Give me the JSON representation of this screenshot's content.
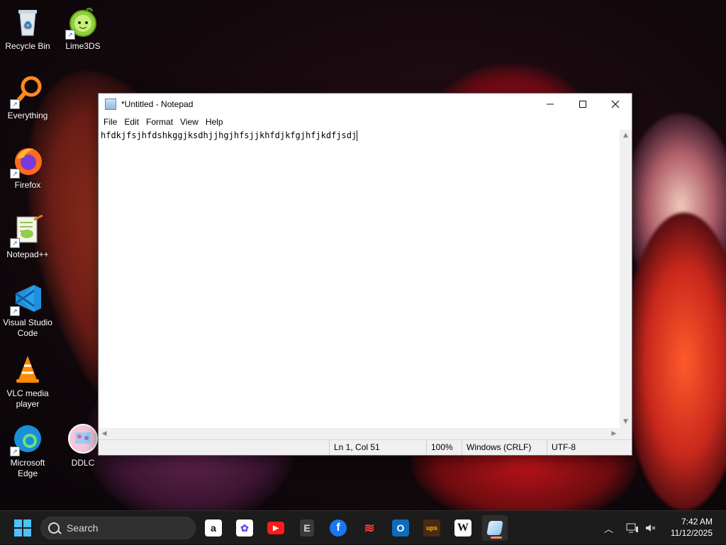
{
  "desktop": {
    "icons": [
      {
        "label": "Recycle Bin",
        "icon": "recycle-bin-icon"
      },
      {
        "label": "Lime3DS",
        "icon": "lime3ds-icon"
      },
      {
        "label": "Everything",
        "icon": "everything-search-icon"
      },
      {
        "label": "Firefox",
        "icon": "firefox-icon"
      },
      {
        "label": "Notepad++",
        "icon": "notepad-plus-plus-icon"
      },
      {
        "label": "Visual Studio Code",
        "icon": "vscode-icon"
      },
      {
        "label": "VLC media player",
        "icon": "vlc-icon"
      },
      {
        "label": "Microsoft Edge",
        "icon": "edge-icon"
      },
      {
        "label": "DDLC",
        "icon": "ddlc-icon"
      }
    ]
  },
  "notepad": {
    "title": "*Untitled - Notepad",
    "menu": [
      "File",
      "Edit",
      "Format",
      "View",
      "Help"
    ],
    "text": "hfdkjfsjhfdshkggjksdhjjhgjhfsjjkhfdjkfgjhfjkdfjsdj",
    "status": {
      "position": "Ln 1, Col 51",
      "zoom": "100%",
      "line_ending": "Windows (CRLF)",
      "encoding": "UTF-8"
    }
  },
  "taskbar": {
    "search_label": "Search",
    "apps": [
      {
        "name": "amazon-icon",
        "glyph": "a"
      },
      {
        "name": "copilot-icon",
        "glyph": "✿"
      },
      {
        "name": "youtube-icon",
        "glyph": "▶"
      },
      {
        "name": "epic-games-icon",
        "glyph": "E"
      },
      {
        "name": "facebook-icon",
        "glyph": "f"
      },
      {
        "name": "stack-app-icon",
        "glyph": "≋"
      },
      {
        "name": "outlook-icon",
        "glyph": "O"
      },
      {
        "name": "ups-icon",
        "glyph": "ups"
      },
      {
        "name": "wikipedia-icon",
        "glyph": "W"
      },
      {
        "name": "notepad-taskbar-icon",
        "glyph": ""
      }
    ],
    "clock": {
      "time": "7:42 AM",
      "date": "11/12/2025"
    }
  }
}
